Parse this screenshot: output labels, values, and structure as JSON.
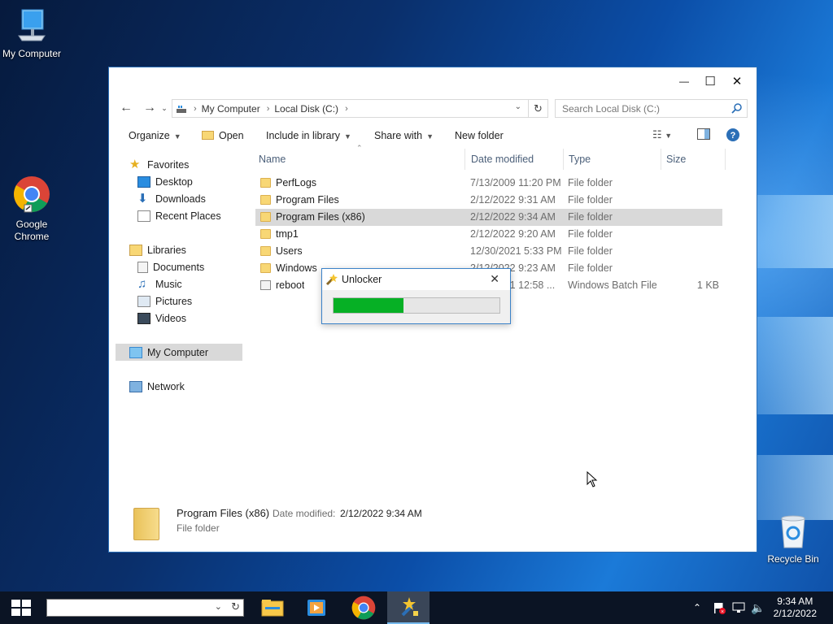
{
  "desktop": {
    "icons": [
      {
        "label": "My Computer"
      },
      {
        "label": "Google Chrome"
      },
      {
        "label": "Recycle Bin"
      }
    ]
  },
  "window": {
    "controls": {
      "minimize": "—",
      "maximize": "☐",
      "close": "✕"
    },
    "address": {
      "segments": [
        "My Computer",
        "Local Disk (C:)"
      ],
      "search_placeholder": "Search Local Disk (C:)"
    },
    "toolbar": {
      "organize": "Organize",
      "open": "Open",
      "include": "Include in library",
      "share": "Share with",
      "new_folder": "New folder"
    },
    "nav": {
      "favorites": "Favorites",
      "desktop": "Desktop",
      "downloads": "Downloads",
      "recent": "Recent Places",
      "libraries": "Libraries",
      "documents": "Documents",
      "music": "Music",
      "pictures": "Pictures",
      "videos": "Videos",
      "my_computer": "My Computer",
      "network": "Network"
    },
    "columns": {
      "name": "Name",
      "date": "Date modified",
      "type": "Type",
      "size": "Size"
    },
    "rows": [
      {
        "name": "PerfLogs",
        "date": "7/13/2009 11:20 PM",
        "type": "File folder",
        "size": ""
      },
      {
        "name": "Program Files",
        "date": "2/12/2022 9:31 AM",
        "type": "File folder",
        "size": ""
      },
      {
        "name": "Program Files (x86)",
        "date": "2/12/2022 9:34 AM",
        "type": "File folder",
        "size": ""
      },
      {
        "name": "tmp1",
        "date": "2/12/2022 9:20 AM",
        "type": "File folder",
        "size": ""
      },
      {
        "name": "Users",
        "date": "12/30/2021 5:33 PM",
        "type": "File folder",
        "size": ""
      },
      {
        "name": "Windows",
        "date": "2/12/2022 9:23 AM",
        "type": "File folder",
        "size": ""
      },
      {
        "name": "reboot",
        "date": "2/12/2021 12:58 ...",
        "type": "Windows Batch File",
        "size": "1 KB"
      }
    ],
    "selected_row": 2,
    "details": {
      "name": "Program Files (x86)",
      "date_label": "Date modified:",
      "date_value": "2/12/2022 9:34 AM",
      "kind": "File folder"
    }
  },
  "dialog": {
    "title": "Unlocker",
    "close": "✕",
    "progress": 0.42
  },
  "taskbar": {
    "time": "9:34 AM",
    "date": "2/12/2022"
  },
  "colors": {
    "progress_fill": "#06b025",
    "selection": "#d9d9d9",
    "window_border": "#2b6fb7"
  }
}
